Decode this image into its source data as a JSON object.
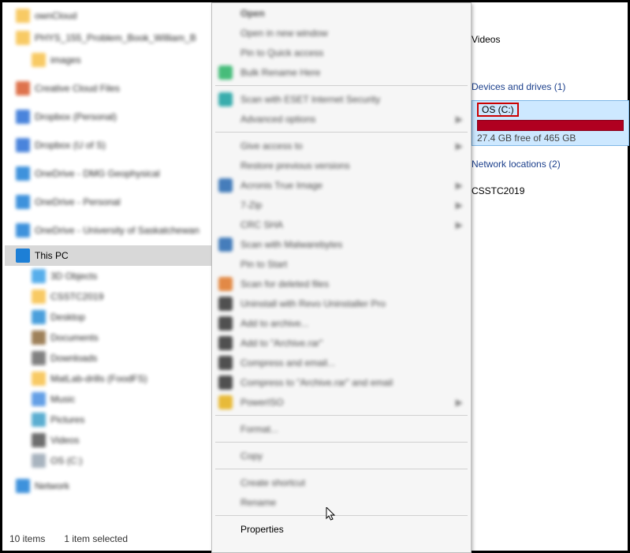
{
  "sidebar": {
    "items": [
      {
        "label": "ownCloud",
        "cls": "ic-folder",
        "indent": "tree-item"
      },
      {
        "label": "PHYS_155_Problem_Book_William_B",
        "cls": "ic-folder",
        "indent": "tree-item"
      },
      {
        "label": "images",
        "cls": "ic-folder",
        "indent": "tree-item tree-sub"
      },
      {
        "label": "Creative Cloud Files",
        "cls": "ic-cc",
        "indent": "tree-item"
      },
      {
        "label": "Dropbox (Personal)",
        "cls": "ic-dbx",
        "indent": "tree-item"
      },
      {
        "label": "Dropbox (U of S)",
        "cls": "ic-dbx",
        "indent": "tree-item"
      },
      {
        "label": "OneDrive - DMG Geophysical",
        "cls": "ic-one",
        "indent": "tree-item"
      },
      {
        "label": "OneDrive - Personal",
        "cls": "ic-one",
        "indent": "tree-item"
      },
      {
        "label": "OneDrive - University of Saskatchewan",
        "cls": "ic-one",
        "indent": "tree-item"
      }
    ],
    "thispc": {
      "label": "This PC"
    },
    "sub": [
      {
        "label": "3D Objects",
        "cls": "ic-obj"
      },
      {
        "label": "CSSTC2019",
        "cls": "ic-folder"
      },
      {
        "label": "Desktop",
        "cls": "ic-desk"
      },
      {
        "label": "Documents",
        "cls": "ic-doc"
      },
      {
        "label": "Downloads",
        "cls": "ic-down"
      },
      {
        "label": "MatLab-drills (FoodFS)",
        "cls": "ic-folder"
      },
      {
        "label": "Music",
        "cls": "ic-music"
      },
      {
        "label": "Pictures",
        "cls": "ic-pict"
      },
      {
        "label": "Videos",
        "cls": "ic-video"
      },
      {
        "label": "OS (C:)",
        "cls": "ic-drive"
      }
    ],
    "network": {
      "label": "Network"
    }
  },
  "content": {
    "videos_label": "Videos",
    "devices_header": "Devices and drives (1)",
    "drive_name": "OS (C:)",
    "drive_usage": "27.4 GB free of 465 GB",
    "network_header": "Network locations (2)",
    "net_item": "CSSTC2019"
  },
  "statusbar": {
    "items_count": "10 items",
    "selection": "1 item selected"
  },
  "context_menu": {
    "groups": [
      [
        {
          "label": "Open",
          "bold": true
        },
        {
          "label": "Open in new window"
        },
        {
          "label": "Pin to Quick access"
        },
        {
          "label": "Bulk Rename Here",
          "icon": "ic-green"
        }
      ],
      [
        {
          "label": "Scan with ESET Internet Security",
          "icon": "ic-eset"
        },
        {
          "label": "Advanced options",
          "submenu": true
        }
      ],
      [
        {
          "label": "Give access to",
          "submenu": true
        },
        {
          "label": "Restore previous versions"
        },
        {
          "label": "Acronis True Image",
          "icon": "ic-acr",
          "submenu": true
        },
        {
          "label": "7-Zip",
          "submenu": true
        },
        {
          "label": "CRC SHA",
          "submenu": true
        },
        {
          "label": "Scan with Malwarebytes",
          "icon": "ic-mwb"
        },
        {
          "label": "Pin to Start"
        },
        {
          "label": "Scan for deleted files",
          "icon": "ic-scan"
        },
        {
          "label": "Uninstall with Revo Uninstaller Pro",
          "icon": "ic-revo"
        },
        {
          "label": "Add to archive...",
          "icon": "ic-arc"
        },
        {
          "label": "Add to \"Archive.rar\"",
          "icon": "ic-arc"
        },
        {
          "label": "Compress and email...",
          "icon": "ic-arc"
        },
        {
          "label": "Compress to \"Archive.rar\" and email",
          "icon": "ic-arc"
        },
        {
          "label": "PowerISO",
          "icon": "ic-power",
          "submenu": true
        }
      ],
      [
        {
          "label": "Format..."
        }
      ],
      [
        {
          "label": "Copy"
        }
      ],
      [
        {
          "label": "Create shortcut"
        },
        {
          "label": "Rename"
        }
      ],
      [
        {
          "label": "Properties",
          "clear": true
        }
      ]
    ]
  }
}
